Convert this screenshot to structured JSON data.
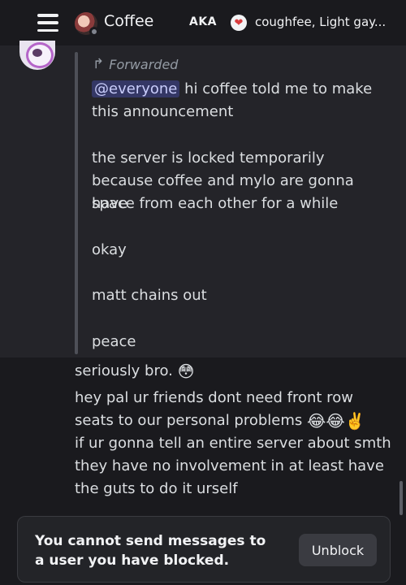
{
  "header": {
    "title": "Coffee",
    "aka_label": "AKA",
    "aka_names": "coughfee, Light gay...",
    "heart_icon": "❤"
  },
  "forwarded_message": {
    "label": "Forwarded",
    "mention": "@everyone",
    "line1": " hi coffee told me to make",
    "line2": "this announcement",
    "line3": "the server is locked temporarily",
    "line4": "because coffee and mylo are gonna have",
    "line5": "space from each other for a while",
    "line6": "okay",
    "line7": "matt chains out",
    "line8": "peace"
  },
  "messages": [
    {
      "text": "seriously bro.",
      "emoji": "😳"
    },
    {
      "line1": "hey pal ur friends dont need front row",
      "line2": "seats to our personal problems",
      "line2_emoji": "😂😂✌️",
      "line3": "if ur gonna tell an entire server about smth",
      "line4": "they have no involvement in at least have",
      "line5": "the guts to do it urself"
    }
  ],
  "blocked_notice": {
    "text": "You cannot send messages to a user you have blocked.",
    "button": "Unblock"
  },
  "colors": {
    "background": "#1a1a1e",
    "forward_panel": "#242429",
    "mention_bg": "#3c4270",
    "status_offline": "#80848e"
  }
}
